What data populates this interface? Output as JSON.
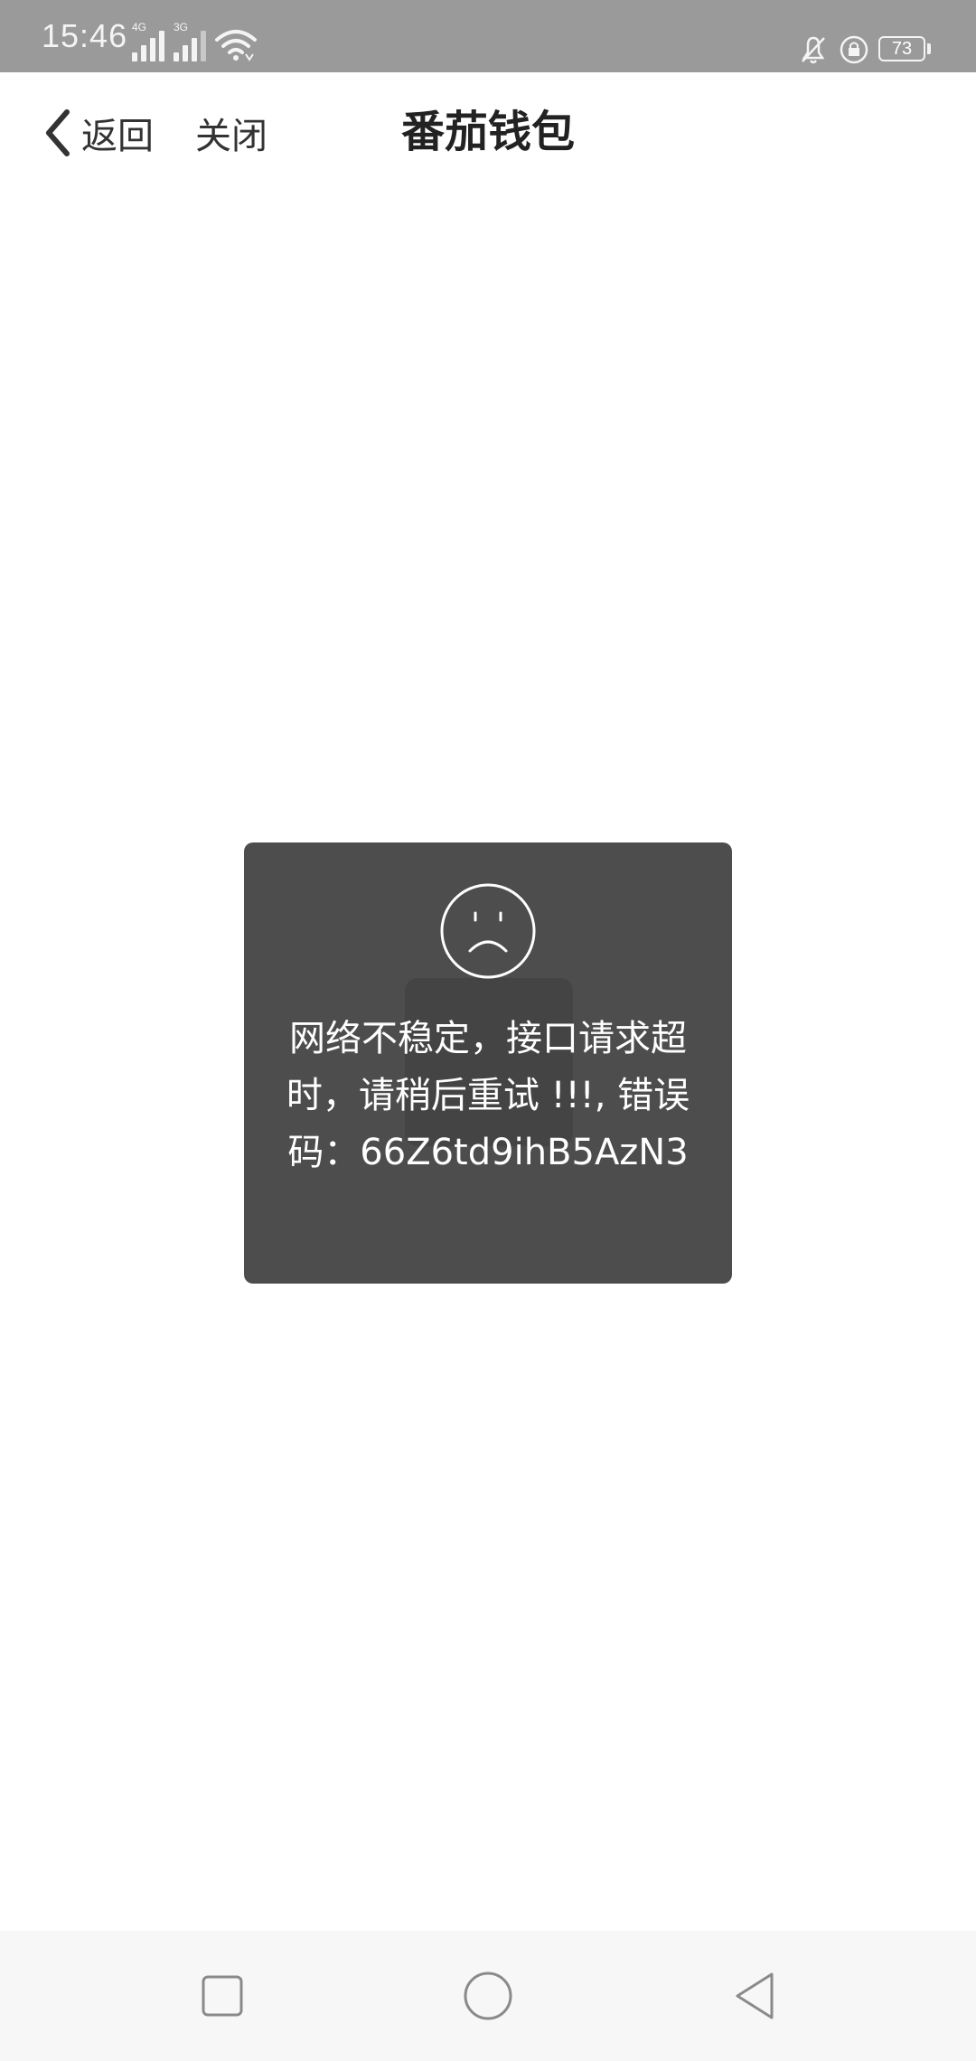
{
  "status_bar": {
    "time": "15:46",
    "signal1_tag": "4G",
    "signal2_tag": "3G",
    "battery": "73",
    "icons": [
      "signal-4g-icon",
      "signal-3g-icon",
      "wifi-icon",
      "bell-off-icon",
      "rotation-lock-icon",
      "battery-icon"
    ]
  },
  "header": {
    "back_label": "返回",
    "close_label": "关闭",
    "title": "番茄钱包"
  },
  "toast": {
    "icon": "sad-face-icon",
    "message": "网络不稳定，接口请求超时，请稍后重试 !!!, 错误码：66Z6td9ihB5AzN3"
  },
  "system_nav": {
    "icons": [
      "recents-square-icon",
      "home-circle-icon",
      "back-triangle-icon"
    ]
  }
}
